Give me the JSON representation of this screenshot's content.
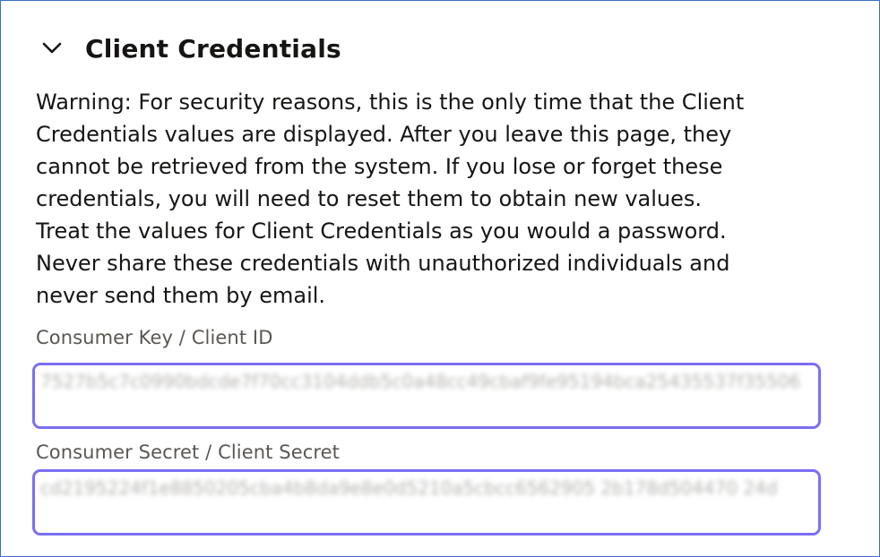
{
  "section": {
    "title": "Client Credentials",
    "toggle_icon": "chevron-down-icon",
    "expanded": true
  },
  "warning": {
    "lines": [
      "Warning: For security reasons, this is the only time that the Client",
      "Credentials values are displayed. After you leave this page, they",
      "cannot be retrieved from the system. If you lose or forget these",
      "credentials, you will need to reset them to obtain new values.",
      "Treat the values for Client Credentials as you would a password.",
      "Never share these credentials with unauthorized individuals and",
      "never send them by email."
    ]
  },
  "fields": {
    "consumer_key": {
      "label": "Consumer Key / Client ID",
      "value": "7527b5c7c0990bdcde7f70cc3104ddb5c0a48cc49cbaf9fe95194bca25435537f35506"
    },
    "consumer_secret": {
      "label": "Consumer Secret / Client Secret",
      "value": "cd2195224f1e8850205cba4b8da9e8e0d5210a5cbcc6562905 2b178d504470 24d"
    }
  },
  "colors": {
    "frame_border": "#3b6fc4",
    "field_border": "#7b6ff2",
    "text": "#161513",
    "label": "#5a5753"
  }
}
